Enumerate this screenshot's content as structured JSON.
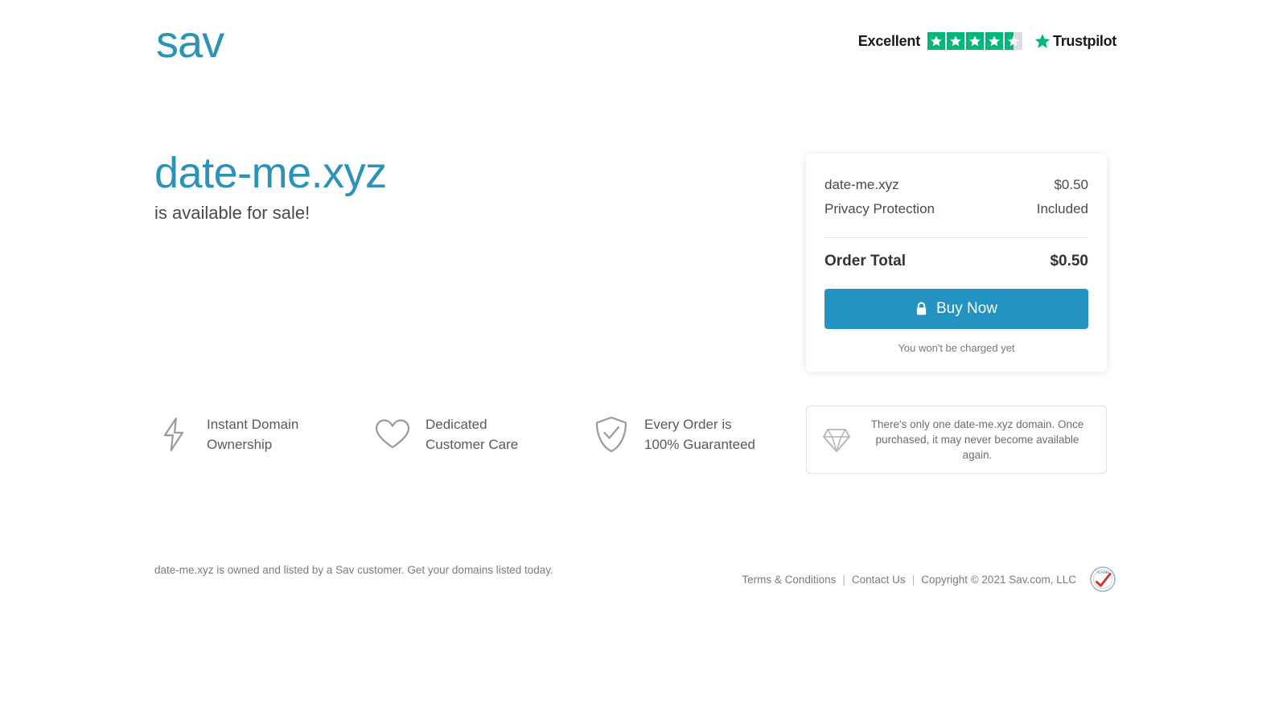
{
  "header": {
    "logo_text": "sav",
    "logo_color": "#2b92b8",
    "trustpilot": {
      "rating_word": "Excellent",
      "brand_name": "Trustpilot",
      "stars_filled": 4,
      "stars_total": 5,
      "half_star": true,
      "star_color": "#00b67a",
      "empty_star_color": "#dcdce6"
    }
  },
  "hero": {
    "domain": "date-me.xyz",
    "subtitle": "is available for sale!"
  },
  "order_card": {
    "line_items": [
      {
        "label": "date-me.xyz",
        "value": "$0.50"
      },
      {
        "label": "Privacy Protection",
        "value": "Included"
      }
    ],
    "total_label": "Order Total",
    "total_value": "$0.50",
    "buy_button_label": "Buy Now",
    "buy_button_color": "#2394c1",
    "charge_note": "You won't be charged yet"
  },
  "features": [
    {
      "icon": "lightning-bolt-icon",
      "line1": "Instant Domain",
      "line2": "Ownership"
    },
    {
      "icon": "heart-icon",
      "line1": "Dedicated",
      "line2": "Customer Care"
    },
    {
      "icon": "shield-check-icon",
      "line1": "Every Order is",
      "line2": "100% Guaranteed"
    }
  ],
  "notice": {
    "icon": "diamond-icon",
    "text": "There's only one date-me.xyz domain. Once purchased, it may never become available again."
  },
  "footer": {
    "left_text": "date-me.xyz is owned and listed by a Sav customer. Get your domains listed today.",
    "links": [
      {
        "label": "Terms & Conditions"
      },
      {
        "label": "Contact Us"
      }
    ],
    "separator": "|",
    "copyright": "Copyright © 2021 Sav.com, LLC",
    "badge": "icann-accredited-badge"
  }
}
